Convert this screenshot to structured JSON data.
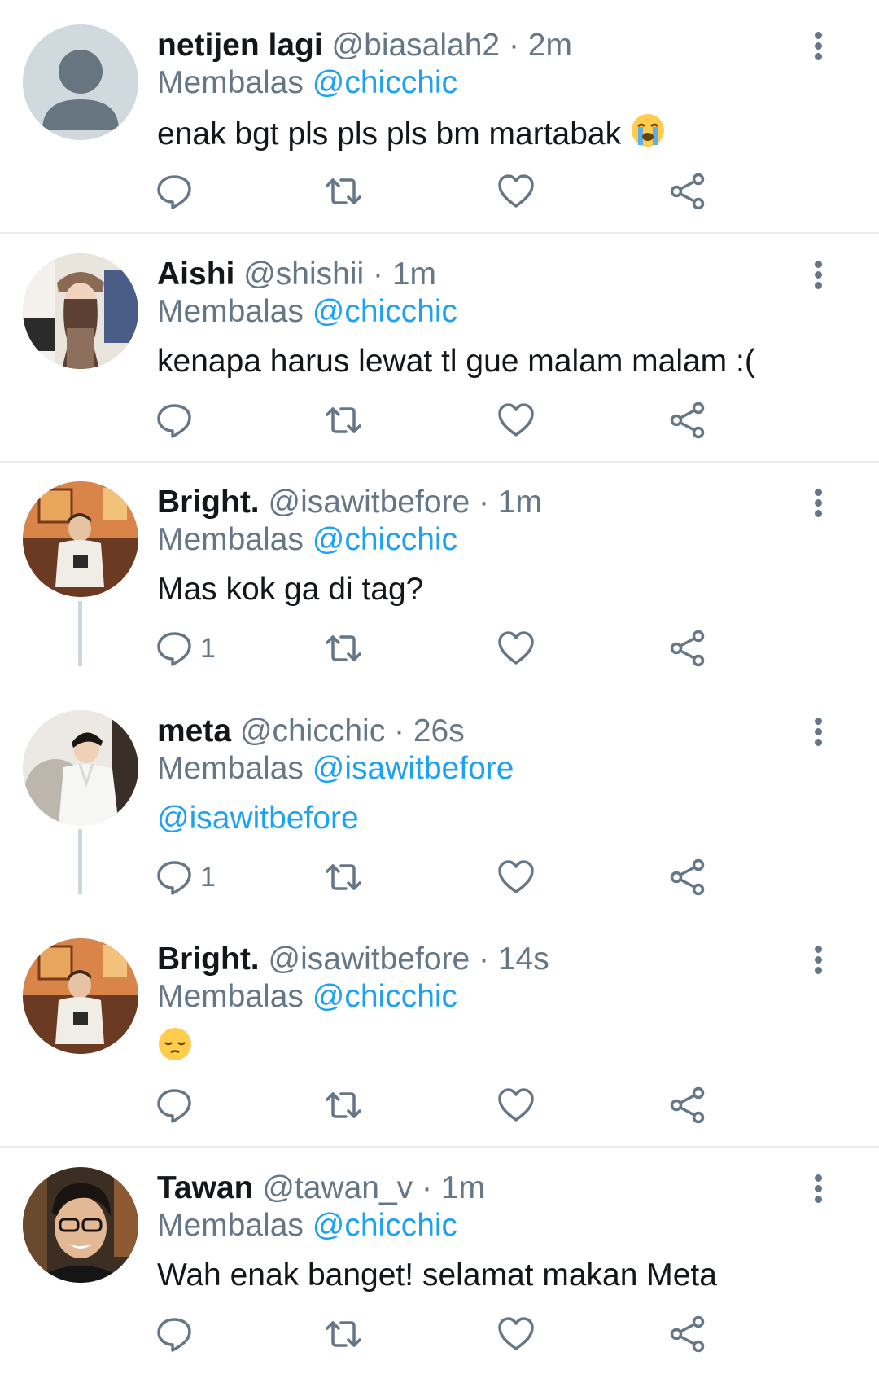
{
  "colors": {
    "link": "#1da1f2",
    "secondary": "#657786",
    "divider": "#e6ecf0",
    "thread_line": "#ccd6dd"
  },
  "reply_prefix": "Membalas",
  "tweets": [
    {
      "name": "netijen lagi",
      "handle": "@biasalah2",
      "time": "· 2m",
      "reply_to": "@chicchic",
      "text": "enak bgt pls pls pls bm martabak",
      "emoji": "loudly-crying-face",
      "reply_count": "",
      "avatar": "default-avatar-icon"
    },
    {
      "name": "Aishi",
      "handle": "@shishii",
      "time": "· 1m",
      "reply_to": "@chicchic",
      "text": "kenapa harus lewat tl gue malam malam :(",
      "reply_count": "",
      "avatar": "user-photo"
    },
    {
      "name": "Bright.",
      "handle": "@isawitbefore",
      "time": "· 1m",
      "reply_to": "@chicchic",
      "text": "Mas kok ga di tag?",
      "reply_count": "1",
      "avatar": "user-photo"
    },
    {
      "name": "meta",
      "handle": "@chicchic",
      "time": "· 26s",
      "reply_to": "@isawitbefore",
      "text": "@isawitbefore",
      "reply_count": "1",
      "avatar": "user-photo"
    },
    {
      "name": "Bright.",
      "handle": "@isawitbefore",
      "time": "· 14s",
      "reply_to": "@chicchic",
      "text": "",
      "emoji": "pensive-face",
      "reply_count": "",
      "avatar": "user-photo"
    },
    {
      "name": "Tawan",
      "handle": "@tawan_v",
      "time": "· 1m",
      "reply_to": "@chicchic",
      "text": "Wah enak banget! selamat makan Meta",
      "reply_count": "",
      "avatar": "user-photo"
    }
  ]
}
